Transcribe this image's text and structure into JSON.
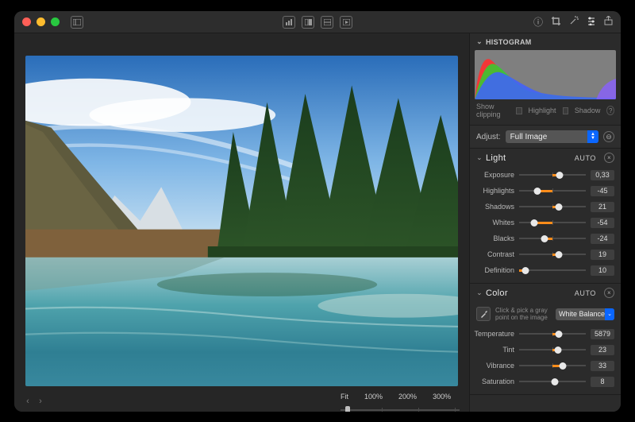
{
  "toolbar": {
    "center_icons": [
      "histogram-icon",
      "compare-icon",
      "layers-icon",
      "grid-icon"
    ],
    "right_icons": [
      "info-icon",
      "crop-icon",
      "magic-icon",
      "adjust-icon",
      "share-icon"
    ]
  },
  "zoom": {
    "labels": [
      "Fit",
      "100%",
      "200%",
      "300%"
    ]
  },
  "panel": {
    "histogram": {
      "title": "Histogram",
      "show_clipping": "Show clipping",
      "highlight": "Highlight",
      "shadow": "Shadow"
    },
    "adjust": {
      "label": "Adjust:",
      "value": "Full Image"
    },
    "light": {
      "title": "Light",
      "auto": "AUTO",
      "sliders": [
        {
          "label": "Exposure",
          "value": "0,33",
          "pos": 61,
          "fill_from": 50,
          "fill_to": 61,
          "center": true
        },
        {
          "label": "Highlights",
          "value": "-45",
          "pos": 27,
          "fill_from": 27,
          "fill_to": 50,
          "center": true
        },
        {
          "label": "Shadows",
          "value": "21",
          "pos": 60,
          "fill_from": 50,
          "fill_to": 60,
          "center": true
        },
        {
          "label": "Whites",
          "value": "-54",
          "pos": 23,
          "fill_from": 23,
          "fill_to": 50,
          "center": true
        },
        {
          "label": "Blacks",
          "value": "-24",
          "pos": 38,
          "fill_from": 38,
          "fill_to": 50,
          "center": true
        },
        {
          "label": "Contrast",
          "value": "19",
          "pos": 59,
          "fill_from": 50,
          "fill_to": 59,
          "center": true
        },
        {
          "label": "Definition",
          "value": "10",
          "pos": 10,
          "fill_from": 0,
          "fill_to": 10,
          "center": false
        }
      ]
    },
    "color": {
      "title": "Color",
      "auto": "AUTO",
      "wb": {
        "hint": "Click & pick a gray point on the image",
        "preset": "White Balance"
      },
      "sliders": [
        {
          "label": "Temperature",
          "value": "5879",
          "pos": 60,
          "fill_from": 50,
          "fill_to": 60,
          "center": true
        },
        {
          "label": "Tint",
          "value": "23",
          "pos": 58,
          "fill_from": 50,
          "fill_to": 58,
          "center": true
        },
        {
          "label": "Vibrance",
          "value": "33",
          "pos": 66,
          "fill_from": 50,
          "fill_to": 66,
          "center": true
        },
        {
          "label": "Saturation",
          "value": "8",
          "pos": 54,
          "fill_from": 50,
          "fill_to": 54,
          "center": true
        }
      ]
    }
  }
}
